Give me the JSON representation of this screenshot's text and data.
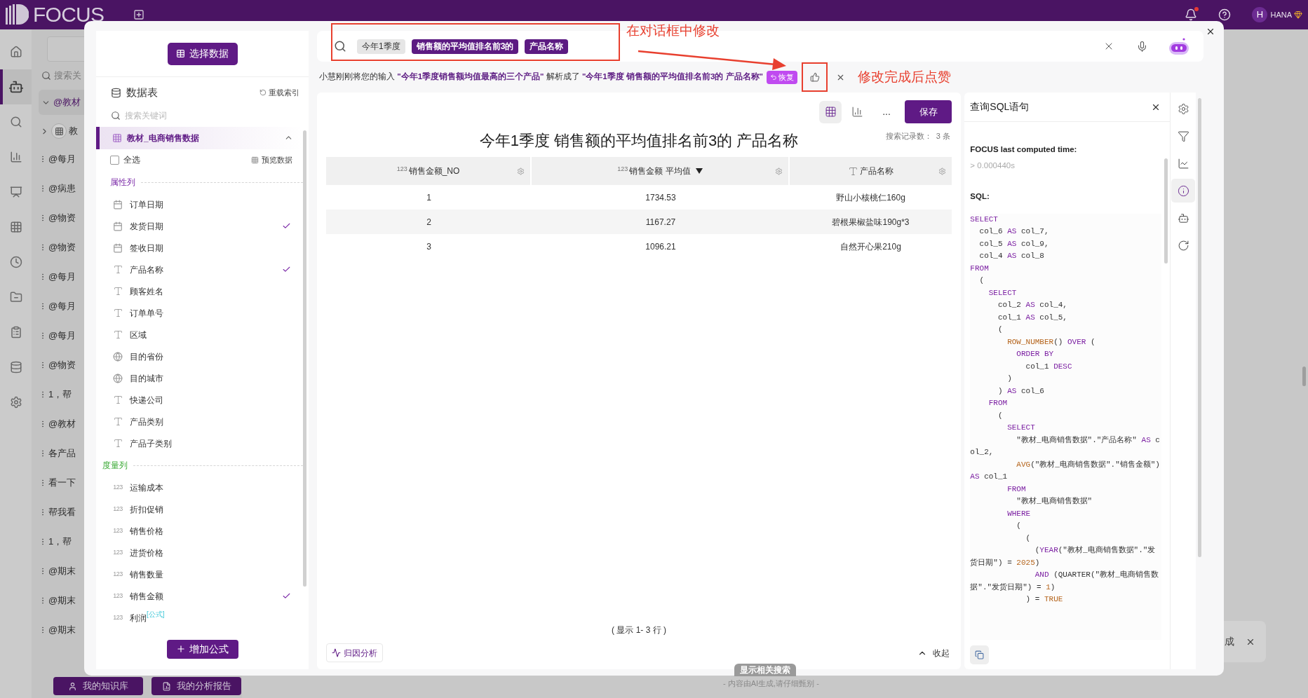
{
  "top_bar": {
    "logo": "FOCUS",
    "user": {
      "initial": "H",
      "name": "HANA"
    }
  },
  "nav_rail": [
    {
      "kind": "home",
      "selected": false
    },
    {
      "kind": "robot",
      "selected": true
    },
    {
      "kind": "search",
      "selected": false
    },
    {
      "kind": "chart",
      "selected": false
    },
    {
      "kind": "presentation",
      "selected": false
    },
    {
      "kind": "table",
      "selected": false
    },
    {
      "kind": "clock",
      "selected": false
    },
    {
      "kind": "folder",
      "selected": false
    },
    {
      "kind": "clipboard",
      "selected": false
    },
    {
      "kind": "database",
      "selected": false
    },
    {
      "kind": "settings",
      "selected": false
    }
  ],
  "history": {
    "search_placeholder": "搜索关",
    "items": [
      {
        "kind": "folder",
        "label": "@教材",
        "expanded": true
      },
      {
        "kind": "dataset",
        "label": "教"
      },
      {
        "kind": "chat",
        "label": "@每月"
      },
      {
        "kind": "chat",
        "label": "@病患"
      },
      {
        "kind": "chat",
        "label": "@物资"
      },
      {
        "kind": "chat",
        "label": "@物资"
      },
      {
        "kind": "chat",
        "label": "@每月"
      },
      {
        "kind": "chat",
        "label": "@每月"
      },
      {
        "kind": "chat",
        "label": "@每月"
      },
      {
        "kind": "chat",
        "label": "@物资"
      },
      {
        "kind": "chat",
        "label": "1，帮"
      },
      {
        "kind": "chat",
        "label": "@教材"
      },
      {
        "kind": "chat",
        "label": "各产品"
      },
      {
        "kind": "chat",
        "label": "看一下"
      },
      {
        "kind": "chat",
        "label": "帮我看"
      },
      {
        "kind": "chat",
        "label": "1，帮"
      },
      {
        "kind": "chat",
        "label": "@期末"
      },
      {
        "kind": "chat",
        "label": "@期末"
      },
      {
        "kind": "chat",
        "label": "@期末"
      }
    ]
  },
  "bottom_buttons": [
    {
      "kind": "knowledge",
      "label": "我的知识库"
    },
    {
      "kind": "report",
      "label": "我的分析报告"
    }
  ],
  "dialog": {
    "data_panel": {
      "select_button": "选择数据",
      "title": "数据表",
      "reload": "重载索引",
      "search_placeholder": "搜索关键词",
      "table": {
        "name": "教材_电商销售数据",
        "expanded": true,
        "selected": true
      },
      "select_all": {
        "label": "全选",
        "checked": false
      },
      "preview": "预览数据",
      "sections": [
        {
          "kind": "attribute",
          "label": "属性列",
          "fields": [
            {
              "kind": "date",
              "label": "订单日期",
              "checked": false
            },
            {
              "kind": "date",
              "label": "发货日期",
              "checked": true
            },
            {
              "kind": "date",
              "label": "签收日期",
              "checked": false
            },
            {
              "kind": "text",
              "label": "产品名称",
              "checked": true
            },
            {
              "kind": "text",
              "label": "顾客姓名",
              "checked": false
            },
            {
              "kind": "text",
              "label": "订单单号",
              "checked": false
            },
            {
              "kind": "text",
              "label": "区域",
              "checked": false
            },
            {
              "kind": "geo",
              "label": "目的省份",
              "checked": false
            },
            {
              "kind": "geo",
              "label": "目的城市",
              "checked": false
            },
            {
              "kind": "text",
              "label": "快递公司",
              "checked": false
            },
            {
              "kind": "text",
              "label": "产品类别",
              "checked": false
            },
            {
              "kind": "text",
              "label": "产品子类别",
              "checked": false
            }
          ]
        },
        {
          "kind": "measure",
          "label": "度量列",
          "fields": [
            {
              "kind": "number",
              "badge": "123",
              "label": "运输成本",
              "checked": false
            },
            {
              "kind": "number",
              "badge": "123",
              "label": "折扣促销",
              "checked": false
            },
            {
              "kind": "number",
              "badge": "123",
              "label": "销售价格",
              "checked": false
            },
            {
              "kind": "number",
              "badge": "123",
              "label": "进货价格",
              "checked": false
            },
            {
              "kind": "number",
              "badge": "123",
              "label": "销售数量",
              "checked": false
            },
            {
              "kind": "number",
              "badge": "123",
              "label": "销售金额",
              "checked": true
            },
            {
              "kind": "number",
              "badge": "123",
              "label": "利润",
              "tag": "[公式]",
              "checked": false
            }
          ]
        }
      ],
      "add_formula": "增加公式"
    },
    "search": {
      "tokens": [
        {
          "kind": "filter",
          "text": "今年1季度"
        },
        {
          "kind": "measure",
          "text": "销售额的平均值排名前3的"
        },
        {
          "kind": "column",
          "text": "产品名称"
        }
      ]
    },
    "parse_notice": {
      "text": "小慧刚刚将您的输入 **\"今年1季度销售额均值最高的三个产品\"** 解析成了 **\"今年1季度 销售额的平均值排名前3的 产品名称\"**",
      "restore": "恢复"
    },
    "annotations": [
      {
        "kind": "search_hint",
        "text": "在对话框中修改"
      },
      {
        "kind": "like_hint",
        "text": "修改完成后点赞"
      }
    ],
    "result": {
      "view_buttons": [
        {
          "kind": "table",
          "selected": true
        },
        {
          "kind": "chart",
          "selected": false
        }
      ],
      "more": "...",
      "save": "保存",
      "title": "今年1季度 销售额的平均值排名前3的 产品名称",
      "record_count": "搜索记录数：  3 条",
      "table": {
        "columns": [
          {
            "kind": "number",
            "badge": "123",
            "label": "销售金额_NO",
            "sorted": false
          },
          {
            "kind": "number",
            "badge": "123",
            "label": "销售金额 平均值",
            "sorted": true
          },
          {
            "kind": "text",
            "label": "产品名称",
            "sorted": false
          }
        ],
        "rows": [
          [
            "1",
            "1734.53",
            "野山小核桃仁160g"
          ],
          [
            "2",
            "1167.27",
            "碧根果椒盐味190g*3"
          ],
          [
            "3",
            "1096.21",
            "自然开心果210g"
          ]
        ]
      },
      "rows_shown": "( 显示 1- 3 行 )",
      "attribution": "归因分析",
      "collapse": "收起"
    },
    "sql_panel": {
      "title": "查询SQL语句",
      "computed_label": "FOCUS last computed time:",
      "computed_value": "> 0.000440s",
      "sql_label": "SQL:",
      "code": [
        [
          {
            "kind": "keyword",
            "text": "SELECT"
          }
        ],
        [
          {
            "kind": "text",
            "text": "  col_6 "
          },
          {
            "kind": "keyword",
            "text": "AS"
          },
          {
            "kind": "text",
            "text": " col_7,"
          }
        ],
        [
          {
            "kind": "text",
            "text": "  col_5 "
          },
          {
            "kind": "keyword",
            "text": "AS"
          },
          {
            "kind": "text",
            "text": " col_9,"
          }
        ],
        [
          {
            "kind": "text",
            "text": "  col_4 "
          },
          {
            "kind": "keyword",
            "text": "AS"
          },
          {
            "kind": "text",
            "text": " col_8"
          }
        ],
        [
          {
            "kind": "keyword",
            "text": "FROM"
          }
        ],
        [
          {
            "kind": "text",
            "text": "  ("
          }
        ],
        [
          {
            "kind": "keyword",
            "text": "    SELECT"
          }
        ],
        [
          {
            "kind": "text",
            "text": "      col_2 "
          },
          {
            "kind": "keyword",
            "text": "AS"
          },
          {
            "kind": "text",
            "text": " col_4,"
          }
        ],
        [
          {
            "kind": "text",
            "text": "      col_1 "
          },
          {
            "kind": "keyword",
            "text": "AS"
          },
          {
            "kind": "text",
            "text": " col_5,"
          }
        ],
        [
          {
            "kind": "text",
            "text": "      ("
          }
        ],
        [
          {
            "kind": "function",
            "text": "        ROW_NUMBER"
          },
          {
            "kind": "text",
            "text": "() "
          },
          {
            "kind": "keyword",
            "text": "OVER"
          },
          {
            "kind": "text",
            "text": " ("
          }
        ],
        [
          {
            "kind": "keyword",
            "text": "          ORDER BY"
          }
        ],
        [
          {
            "kind": "text",
            "text": "            col_1 "
          },
          {
            "kind": "keyword",
            "text": "DESC"
          }
        ],
        [
          {
            "kind": "text",
            "text": "        )"
          }
        ],
        [
          {
            "kind": "text",
            "text": "      ) "
          },
          {
            "kind": "keyword",
            "text": "AS"
          },
          {
            "kind": "text",
            "text": " col_6"
          }
        ],
        [
          {
            "kind": "keyword",
            "text": "    FROM"
          }
        ],
        [
          {
            "kind": "text",
            "text": "      ("
          }
        ],
        [
          {
            "kind": "keyword",
            "text": "        SELECT"
          }
        ],
        [
          {
            "kind": "text",
            "text": "          \"教材_电商销售数据\".\"产品名称\" "
          },
          {
            "kind": "keyword",
            "text": "AS"
          },
          {
            "kind": "text",
            "text": " col_2,"
          }
        ],
        [
          {
            "kind": "function",
            "text": "          AVG"
          },
          {
            "kind": "text",
            "text": "(\"教材_电商销售数据\".\"销售金额\") "
          },
          {
            "kind": "keyword",
            "text": "AS"
          },
          {
            "kind": "text",
            "text": " col_1"
          }
        ],
        [
          {
            "kind": "keyword",
            "text": "        FROM"
          }
        ],
        [
          {
            "kind": "text",
            "text": "          \"教材_电商销售数据\""
          }
        ],
        [
          {
            "kind": "keyword",
            "text": "        WHERE"
          }
        ],
        [
          {
            "kind": "text",
            "text": "          ("
          }
        ],
        [
          {
            "kind": "text",
            "text": "            ("
          }
        ],
        [
          {
            "kind": "text",
            "text": "              ("
          },
          {
            "kind": "keyword",
            "text": "YEAR"
          },
          {
            "kind": "text",
            "text": "(\"教材_电商销售数据\".\"发货日期\") = "
          },
          {
            "kind": "literal",
            "text": "2025"
          },
          {
            "kind": "text",
            "text": ")"
          }
        ],
        [
          {
            "kind": "keyword",
            "text": "              AND"
          },
          {
            "kind": "text",
            "text": " (QUARTER(\"教材_电商销售数据\".\"发货日期\") = "
          },
          {
            "kind": "literal",
            "text": "1"
          },
          {
            "kind": "text",
            "text": ")"
          }
        ],
        [
          {
            "kind": "text",
            "text": "            ) = "
          },
          {
            "kind": "literal",
            "text": "TRUE"
          }
        ]
      ]
    },
    "tool_rail": [
      {
        "kind": "settings",
        "selected": false
      },
      {
        "kind": "filter",
        "selected": false
      },
      {
        "kind": "chart",
        "selected": false
      },
      {
        "kind": "info",
        "selected": true
      },
      {
        "kind": "robot",
        "selected": false
      },
      {
        "kind": "refresh",
        "selected": false
      }
    ]
  },
  "related_search": "显示相关搜索",
  "disclaimer": "- 内容由AI生成,请仔细甄别 -",
  "toast": {
    "text": "成"
  }
}
